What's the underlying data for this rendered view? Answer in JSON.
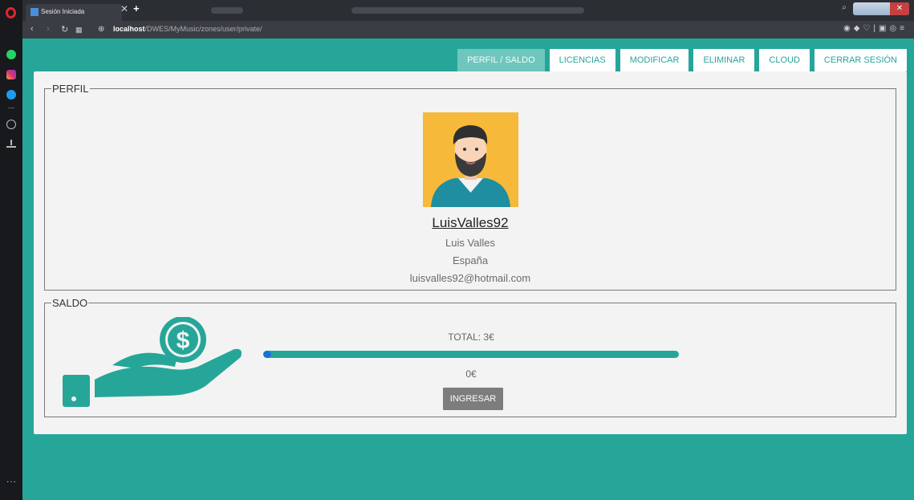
{
  "browser": {
    "tab_title": "Sesión Iniciada",
    "url_host": "localhost",
    "url_path": "/DWES/MyMusic/zones/user/private/",
    "more": "..."
  },
  "menu": {
    "items": [
      "PERFIL / SALDO",
      "LICENCIAS",
      "MODIFICAR",
      "ELIMINAR",
      "CLOUD",
      "CERRAR SESIÓN"
    ]
  },
  "perfil": {
    "legend": "PERFIL",
    "username": "LuisValles92",
    "full_name": "Luis Valles",
    "country": "España",
    "email": "luisvalles92@hotmail.com"
  },
  "saldo": {
    "legend": "SALDO",
    "total": "TOTAL: 3€",
    "amount": "0€",
    "button": "INGRESAR",
    "progress": 0.02
  },
  "colors": {
    "brand": "#26a699",
    "progress_fill": "#1a6fd6",
    "button": "#7d7d7d"
  }
}
